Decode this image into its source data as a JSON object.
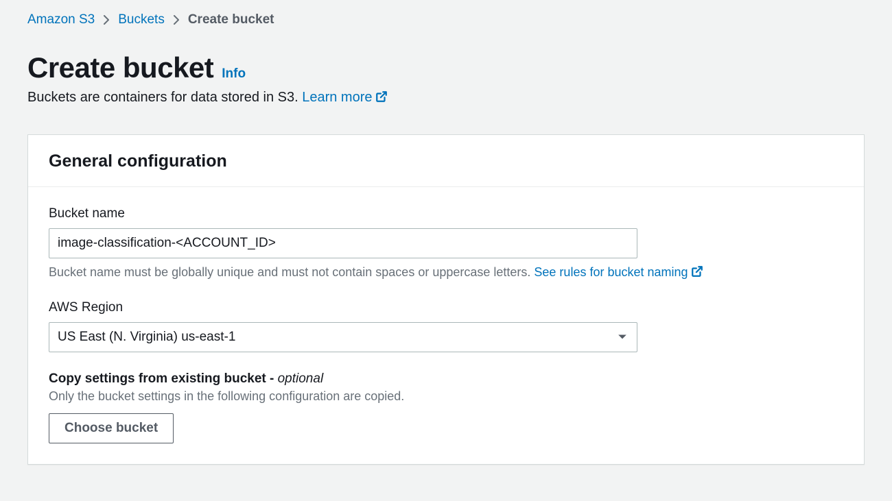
{
  "breadcrumb": {
    "items": [
      {
        "label": "Amazon S3"
      },
      {
        "label": "Buckets"
      }
    ],
    "current": "Create bucket"
  },
  "header": {
    "title": "Create bucket",
    "info_label": "Info",
    "subtitle_prefix": "Buckets are containers for data stored in S3. ",
    "learn_more_label": "Learn more"
  },
  "panel": {
    "title": "General configuration",
    "bucket_name": {
      "label": "Bucket name",
      "value": "image-classification-<ACCOUNT_ID>",
      "hint_prefix": "Bucket name must be globally unique and must not contain spaces or uppercase letters. ",
      "hint_link": "See rules for bucket naming"
    },
    "region": {
      "label": "AWS Region",
      "selected": "US East (N. Virginia) us-east-1"
    },
    "copy": {
      "label_main": "Copy settings from existing bucket ",
      "label_dash": "- ",
      "label_optional": "optional",
      "hint": "Only the bucket settings in the following configuration are copied.",
      "button": "Choose bucket"
    }
  }
}
